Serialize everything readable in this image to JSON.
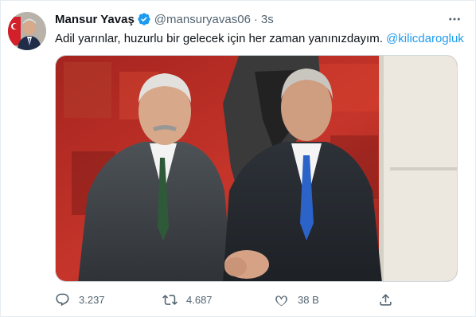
{
  "tweet": {
    "author_name": "Mansur Yavaş",
    "handle": "@mansuryavas06",
    "separator": "·",
    "time": "3s",
    "text": "Adil yarınlar, huzurlu bir gelecek için her zaman yanınızdayım.",
    "mention": "@kilicdarogluk",
    "icons": [
      "verified-badge-icon",
      "more-icon",
      "reply-icon",
      "retweet-icon",
      "like-icon",
      "share-icon"
    ],
    "colors": {
      "accent": "#1d9bf0",
      "secondary_text": "#536471",
      "primary_text": "#0f1419"
    }
  },
  "actions": {
    "reply_count": "3.237",
    "retweet_count": "4.687",
    "like_count": "38 B"
  }
}
